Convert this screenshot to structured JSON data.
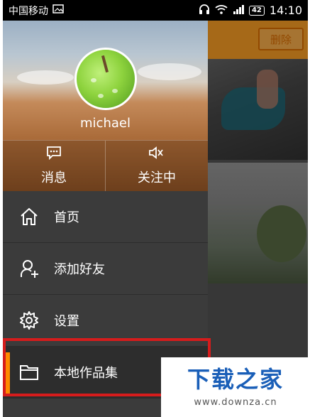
{
  "status_bar": {
    "carrier": "中国移动",
    "battery": "42",
    "time": "14:10"
  },
  "background": {
    "delete_label": "删除"
  },
  "profile": {
    "username": "michael"
  },
  "tabs": [
    {
      "label": "消息",
      "icon": "message-icon"
    },
    {
      "label": "关注中",
      "icon": "speaker-icon"
    }
  ],
  "menu": {
    "items": [
      {
        "label": "首页",
        "icon": "home-icon"
      },
      {
        "label": "添加好友",
        "icon": "add-user-icon"
      },
      {
        "label": "设置",
        "icon": "gear-icon"
      },
      {
        "label": "本地作品集",
        "icon": "folder-icon",
        "active": true
      }
    ]
  },
  "watermark": {
    "title": "下载之家",
    "url": "www.downza.cn"
  },
  "colors": {
    "accent": "#ff8a00",
    "highlight_border": "#d61c1c",
    "topbar": "#ffa126",
    "watermark": "#1a5fb8"
  }
}
